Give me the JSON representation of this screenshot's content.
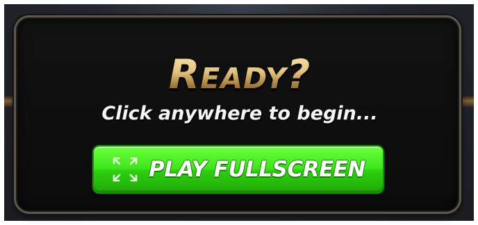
{
  "dialog": {
    "title": "Ready?",
    "subtitle": "Click anywhere to begin...",
    "play_button_label": "PLAY FULLSCREEN",
    "play_button_icon": "fullscreen-icon"
  },
  "colors": {
    "title_gold": "#e4c27d",
    "button_green": "#3fe51d",
    "panel_bg": "#121212",
    "panel_border": "#5e574d"
  }
}
